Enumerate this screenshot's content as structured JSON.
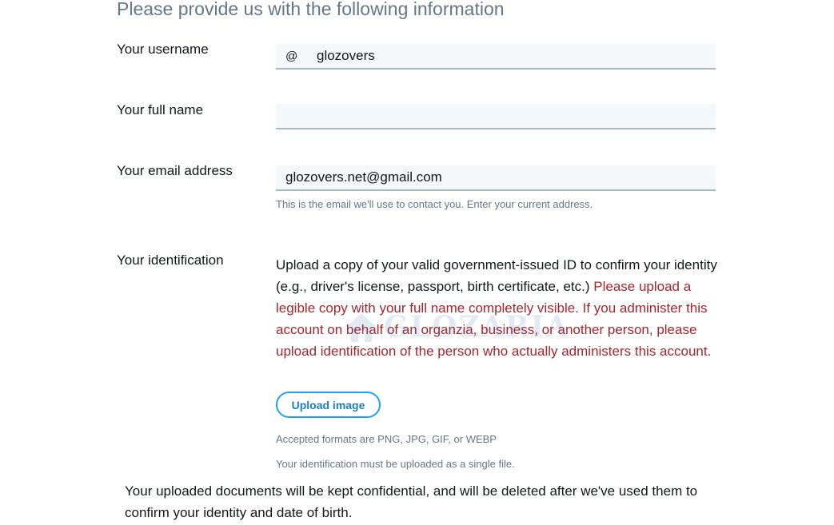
{
  "heading": "Please provide us with the following information",
  "username": {
    "label": "Your username",
    "prefix": "@",
    "value": "glozovers"
  },
  "full_name": {
    "label": "Your full name",
    "value": ""
  },
  "email": {
    "label": "Your email address",
    "value": "glozovers.net@gmail.com",
    "help": "This is the email we'll use to contact you. Enter your current address."
  },
  "identification": {
    "label": "Your identification",
    "instructions": "Upload a copy of your valid government-issued ID to confirm your identity (e.g., driver's license, passport, birth certificate, etc.)",
    "warning": "Please upload a legible copy with your full name completely visible. If you administer this account on behalf of an organzia, business, or another person, please upload identification of the person who actually administers this account.",
    "upload_button": "Upload image",
    "formats_note": "Accepted formats are PNG, JPG, GIF, or WEBP",
    "single_file_note": "Your identification must be uploaded as a single file."
  },
  "confidential_note": "Your uploaded documents will be kept confidential, and will be deleted after we've used them to confirm your identity and date of birth.",
  "watermark": {
    "text": "GLOZARIA",
    "color": "#1f5fa8"
  },
  "colors": {
    "accent": "#1da1f2",
    "warning": "#a4262c",
    "muted": "#657786",
    "field_bg": "#f5f8fa"
  }
}
